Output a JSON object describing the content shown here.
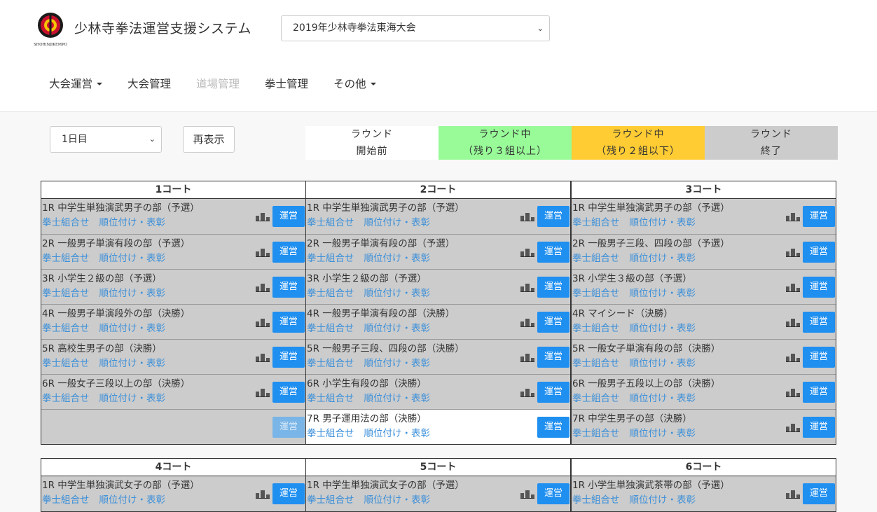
{
  "header": {
    "logo_text": "SHORINJIKEMPO",
    "title": "少林寺拳法運営支援システム",
    "tournament_select": "2019年少林寺拳法東海大会"
  },
  "nav": [
    {
      "label": "大会運営",
      "dropdown": true,
      "disabled": false
    },
    {
      "label": "大会管理",
      "dropdown": false,
      "disabled": false
    },
    {
      "label": "道場管理",
      "dropdown": false,
      "disabled": true
    },
    {
      "label": "拳士管理",
      "dropdown": false,
      "disabled": false
    },
    {
      "label": "その他",
      "dropdown": true,
      "disabled": false
    }
  ],
  "controls": {
    "day_select": "1日目",
    "reload_label": "再表示"
  },
  "legend": [
    {
      "line1": "ラウンド",
      "line2": "開始前",
      "color": "#ffffff"
    },
    {
      "line1": "ラウンド中",
      "line2": "（残り３組以上）",
      "color": "#98fb98"
    },
    {
      "line1": "ラウンド中",
      "line2": "（残り２組以下）",
      "color": "#ffcc33"
    },
    {
      "line1": "ラウンド",
      "line2": "終了",
      "color": "#cccccc"
    }
  ],
  "links": {
    "pairing": "拳士組合せ",
    "ranking": "順位付け・表彰",
    "operate": "運営"
  },
  "courts": [
    {
      "name": "1コート",
      "rows": [
        {
          "title": "1R 中学生単独演武男子の部（予選）",
          "state": "done"
        },
        {
          "title": "2R 一般男子単演有段の部（予選）",
          "state": "done"
        },
        {
          "title": "3R 小学生２級の部（予選）",
          "state": "done"
        },
        {
          "title": "4R 一般男子単演段外の部（決勝）",
          "state": "done"
        },
        {
          "title": "5R 高校生男子の部（決勝）",
          "state": "done"
        },
        {
          "title": "6R 一般女子三段以上の部（決勝）",
          "state": "done"
        },
        {
          "title": "",
          "state": "empty"
        }
      ]
    },
    {
      "name": "2コート",
      "rows": [
        {
          "title": "1R 中学生単独演武男子の部（予選）",
          "state": "done"
        },
        {
          "title": "2R 一般男子単演有段の部（予選）",
          "state": "done"
        },
        {
          "title": "3R 小学生２級の部（予選）",
          "state": "done"
        },
        {
          "title": "4R 一般男子単演有段の部（決勝）",
          "state": "done"
        },
        {
          "title": "5R 一般男子三段、四段の部（決勝）",
          "state": "done"
        },
        {
          "title": "6R 小学生有段の部（決勝）",
          "state": "done"
        },
        {
          "title": "7R 男子運用法の部（決勝）",
          "state": "before"
        }
      ]
    },
    {
      "name": "3コート",
      "rows": [
        {
          "title": "1R 中学生単独演武男子の部（予選）",
          "state": "done"
        },
        {
          "title": "2R 一般男子三段、四段の部（予選）",
          "state": "done"
        },
        {
          "title": "3R 小学生３級の部（予選）",
          "state": "done"
        },
        {
          "title": "4R マイシード（決勝）",
          "state": "done"
        },
        {
          "title": "5R 一般女子単演有段の部（決勝）",
          "state": "done"
        },
        {
          "title": "6R 一般男子五段以上の部（決勝）",
          "state": "done"
        },
        {
          "title": "7R 中学生男子の部（決勝）",
          "state": "done"
        }
      ]
    },
    {
      "name": "4コート",
      "rows": [
        {
          "title": "1R 中学生単独演武女子の部（予選）",
          "state": "done"
        }
      ]
    },
    {
      "name": "5コート",
      "rows": [
        {
          "title": "1R 中学生単独演武女子の部（予選）",
          "state": "done"
        }
      ]
    },
    {
      "name": "6コート",
      "rows": [
        {
          "title": "1R 小学生単独演武茶帯の部（予選）",
          "state": "done"
        }
      ]
    }
  ]
}
